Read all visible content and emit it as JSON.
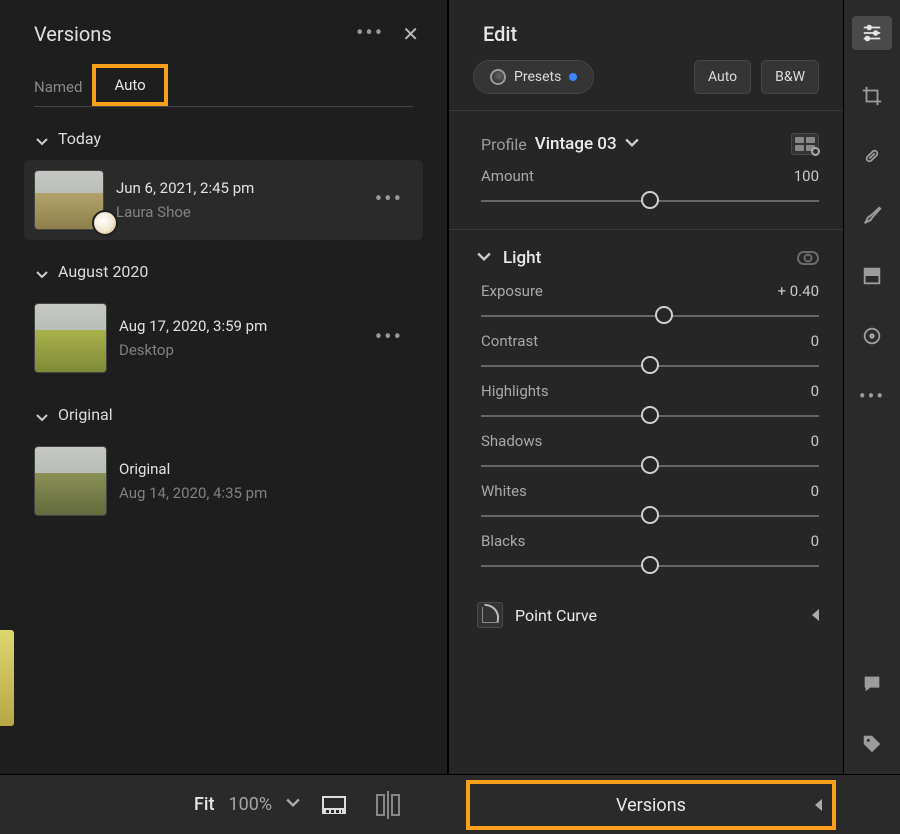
{
  "versions_panel": {
    "title": "Versions",
    "tabs": {
      "named": "Named",
      "auto": "Auto"
    },
    "groups": {
      "today": {
        "label": "Today",
        "item": {
          "date": "Jun 6, 2021, 2:45 pm",
          "source": "Laura Shoe"
        }
      },
      "aug2020": {
        "label": "August 2020",
        "item": {
          "date": "Aug 17, 2020, 3:59 pm",
          "source": "Desktop"
        }
      },
      "original": {
        "label": "Original",
        "item": {
          "date": "Original",
          "source": "Aug 14, 2020, 4:35 pm"
        }
      }
    }
  },
  "footer": {
    "fit": "Fit",
    "zoom": "100%",
    "versions_button": "Versions"
  },
  "edit_panel": {
    "title": "Edit",
    "presets_label": "Presets",
    "auto_chip": "Auto",
    "bw_chip": "B&W",
    "profile_label": "Profile",
    "profile_name": "Vintage 03",
    "amount": {
      "label": "Amount",
      "value": "100",
      "pos": 50
    },
    "light_section": "Light",
    "sliders": {
      "exposure": {
        "label": "Exposure",
        "value": "+ 0.40",
        "pos": 54
      },
      "contrast": {
        "label": "Contrast",
        "value": "0",
        "pos": 50
      },
      "highlights": {
        "label": "Highlights",
        "value": "0",
        "pos": 50
      },
      "shadows": {
        "label": "Shadows",
        "value": "0",
        "pos": 50
      },
      "whites": {
        "label": "Whites",
        "value": "0",
        "pos": 50
      },
      "blacks": {
        "label": "Blacks",
        "value": "0",
        "pos": 50
      }
    },
    "point_curve": "Point Curve"
  },
  "highlight_color": "#f8a01c"
}
